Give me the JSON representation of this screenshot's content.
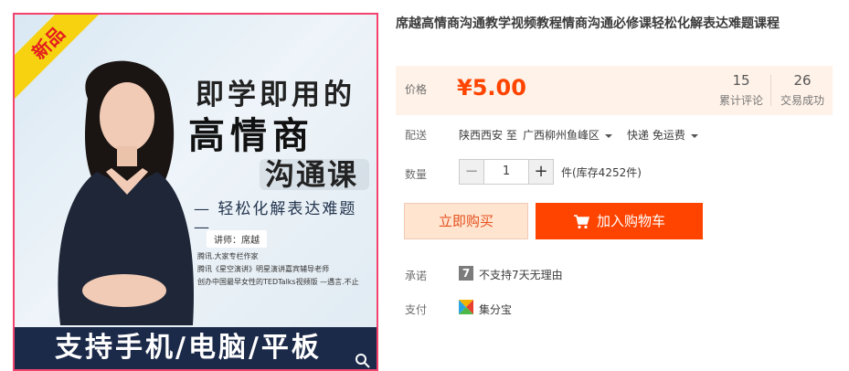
{
  "image": {
    "ribbon": "新品",
    "headline1": "即学即用的",
    "headline2": "高情商",
    "headline3": "沟通课",
    "subtitle": "— 轻松化解表达难题 —",
    "teacher": "讲师：席越",
    "bio": [
      "腾讯.大家专栏作家",
      "腾讯《星空演讲》明星演讲嘉宾辅导老师",
      "创办中国最早女性的TEDTalks视频版 —遇言.不止"
    ],
    "bottom_banner": "支持手机/电脑/平板",
    "zoom_icon": "search-icon"
  },
  "product": {
    "title": "席越高情商沟通教学视频教程情商沟通必修课轻松化解表达难题课程"
  },
  "price": {
    "label": "价格",
    "value": "¥5.00",
    "reviews_count": "15",
    "reviews_label": "累计评论",
    "sales_count": "26",
    "sales_label": "交易成功"
  },
  "shipping": {
    "label": "配送",
    "from": "陕西西安 至",
    "to": "广西柳州鱼峰区",
    "method": "快递 免运费"
  },
  "quantity": {
    "label": "数量",
    "minus": "−",
    "value": "1",
    "plus": "+",
    "stock": "件(库存4252件)"
  },
  "actions": {
    "buy_now": "立即购买",
    "add_to_cart": "加入购物车"
  },
  "promise": {
    "label": "承诺",
    "icon_glyph": "7",
    "text": "不支持7天无理由"
  },
  "payment": {
    "label": "支付",
    "text": "集分宝"
  },
  "colors": {
    "accent": "#ff4400",
    "price": "#ff4400",
    "price_bg": "#fff2e8",
    "image_border": "#f2426d"
  }
}
